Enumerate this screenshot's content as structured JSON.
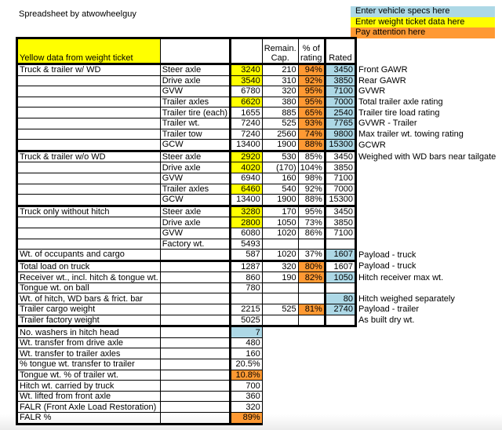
{
  "title": "Spreadsheet by atwowheelguy",
  "legend": [
    {
      "label": "Enter vehicle specs here",
      "color": "#add8e6"
    },
    {
      "label": "Enter weight ticket data here",
      "color": "#ffff00"
    },
    {
      "label": "Pay attention here",
      "color": "#ff9933"
    }
  ],
  "header": {
    "label": "Yellow data from weight ticket",
    "remain_1": "Remain.",
    "remain_2": "Cap.",
    "pct_1": "% of",
    "pct_2": "rating",
    "rated": "Rated"
  },
  "sections": {
    "with_wd": {
      "label": "Truck & trailer w/ WD",
      "rows": [
        {
          "item": "Steer axle",
          "value": "3240",
          "remain": "210",
          "pct": "94%",
          "rated": "3450",
          "note": "Front GAWR"
        },
        {
          "item": "Drive axle",
          "value": "3540",
          "remain": "310",
          "pct": "92%",
          "rated": "3850",
          "note": "Rear GAWR"
        },
        {
          "item": "GVW",
          "value": "6780",
          "remain": "320",
          "pct": "95%",
          "rated": "7100",
          "note": "GVWR"
        },
        {
          "item": "Trailer axles",
          "value": "6620",
          "remain": "380",
          "pct": "95%",
          "rated": "7000",
          "note": "Total trailer axle rating"
        },
        {
          "item": "Trailer tire (each)",
          "value": "1655",
          "remain": "885",
          "pct": "65%",
          "rated": "2540",
          "note": "Trailer tire load rating"
        },
        {
          "item": "Trailer wt.",
          "value": "7240",
          "remain": "525",
          "pct": "93%",
          "rated": "7765",
          "note": "GVWR - Trailer"
        },
        {
          "item": "Trailer tow",
          "value": "7240",
          "remain": "2560",
          "pct": "74%",
          "rated": "9800",
          "note": "Max trailer wt. towing rating"
        },
        {
          "item": "GCW",
          "value": "13400",
          "remain": "1900",
          "pct": "88%",
          "rated": "15300",
          "note": "GCWR"
        }
      ]
    },
    "without_wd": {
      "label": "Truck & trailer w/o WD",
      "rows": [
        {
          "item": "Steer axle",
          "value": "2920",
          "remain": "530",
          "pct": "85%",
          "rated": "3450",
          "note": "Weighed with WD bars near tailgate"
        },
        {
          "item": "Drive axle",
          "value": "4020",
          "remain": "(170)",
          "pct": "104%",
          "rated": "3850",
          "note": ""
        },
        {
          "item": "GVW",
          "value": "6940",
          "remain": "160",
          "pct": "98%",
          "rated": "7100",
          "note": ""
        },
        {
          "item": "Trailer axles",
          "value": "6460",
          "remain": "540",
          "pct": "92%",
          "rated": "7000",
          "note": ""
        },
        {
          "item": "GCW",
          "value": "13400",
          "remain": "1900",
          "pct": "88%",
          "rated": "15300",
          "note": ""
        }
      ]
    },
    "truck_only": {
      "label": "Truck only without hitch",
      "rows": [
        {
          "item": "Steer axle",
          "value": "3280",
          "remain": "170",
          "pct": "95%",
          "rated": "3450"
        },
        {
          "item": "Drive axle",
          "value": "2800",
          "remain": "1050",
          "pct": "73%",
          "rated": "3850"
        },
        {
          "item": "GVW",
          "value": "6080",
          "remain": "1020",
          "pct": "86%",
          "rated": "7100"
        },
        {
          "item": "Factory wt.",
          "value": "5493",
          "remain": "",
          "pct": "",
          "rated": ""
        }
      ],
      "occupants": {
        "label": "Wt. of occupants and cargo",
        "value": "587",
        "remain": "1020",
        "pct": "37%",
        "rated": "1607",
        "note": "Payload - truck"
      }
    },
    "loads": [
      {
        "label": "Total load on truck",
        "value": "1287",
        "remain": "320",
        "pct": "80%",
        "rated": "1607",
        "note": "Payload - truck"
      },
      {
        "label": "Receiver wt., incl. hitch & tongue wt.",
        "value": "860",
        "remain": "190",
        "pct": "82%",
        "rated": "1050",
        "note": "Hitch receiver max wt."
      },
      {
        "label": "Tongue wt. on ball",
        "value": "780",
        "remain": "",
        "pct": "",
        "rated": "",
        "note": ""
      },
      {
        "label": "Wt. of hitch, WD bars & frict. bar",
        "value": "",
        "remain": "",
        "pct": "",
        "rated": "80",
        "note": "Hitch weighed separately"
      },
      {
        "label": "Trailer cargo weight",
        "value": "2215",
        "remain": "525",
        "pct": "81%",
        "rated": "2740",
        "note": "Payload - trailer"
      },
      {
        "label": "Trailer factory weight",
        "value": "5025",
        "remain": "",
        "pct": "",
        "rated": "",
        "note": "As built dry wt."
      }
    ],
    "hitch": [
      {
        "label": "No. washers in hitch head",
        "value": "7"
      },
      {
        "label": "Wt. transfer from drive axle",
        "value": "480"
      },
      {
        "label": "Wt. transfer to trailer axles",
        "value": "160"
      },
      {
        "label": "% tongue wt. transfer to trailer",
        "value": "20.5%"
      },
      {
        "label": "Tongue wt. % of trailer wt.",
        "value": "10.8%"
      },
      {
        "label": "Hitch wt. carried by truck",
        "value": "700"
      },
      {
        "label": "Wt. lifted from front axle",
        "value": "360"
      },
      {
        "label": "FALR (Front Axle Load Restoration)",
        "value": "320"
      },
      {
        "label": "FALR %",
        "value": "89%"
      }
    ]
  }
}
